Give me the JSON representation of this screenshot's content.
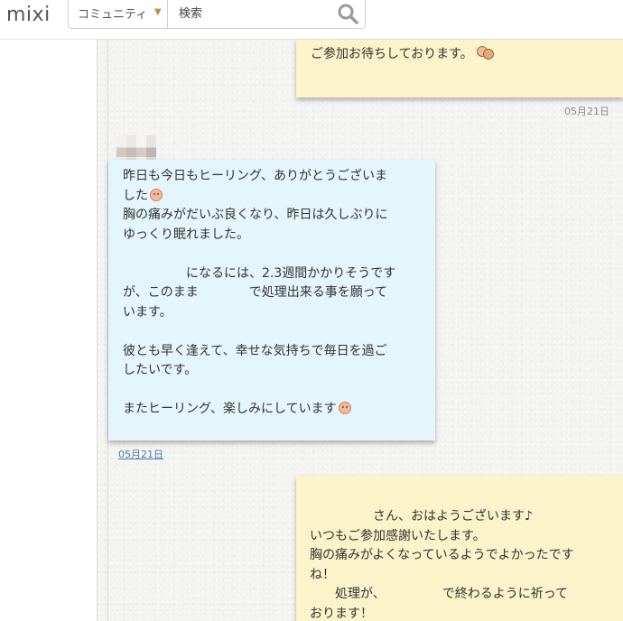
{
  "header": {
    "logo": "mixi",
    "scope_label": "コミュニティ",
    "search_placeholder": "検索"
  },
  "messages": [
    {
      "side": "right",
      "color": "yellow",
      "lines": [
        "ご参加お待ちしております。"
      ],
      "emoji": "faces-emoji",
      "date": "05月21日"
    },
    {
      "side": "left",
      "color": "blue",
      "paragraphs": [
        "昨日も今日もヒーリング、ありがとうございま\nした",
        "胸の痛みがだいぶ良くなり、昨日は久しぶりに\nゆっくり眠れました。",
        "",
        "　　　　　になるには、2.3週間かかりそうです\nが、このまま　　　　で処理出来る事を願って\nいます。",
        "",
        "彼とも早く逢えて、幸せな気持ちで毎日を過ご\nしたいです。",
        "",
        "またヒーリング、楽しみにしています"
      ],
      "date": "05月21日"
    },
    {
      "side": "right",
      "color": "yellow",
      "paragraphs": [
        "　　　　　さん、おはようございます♪",
        "いつもご参加感謝いたします。",
        "胸の痛みがよくなっているようでよかったです\nね！",
        "　　処理が、　　　　　で終わるように祈って\nおります！"
      ]
    }
  ],
  "colors": {
    "yellow_note": "#fbf3c9",
    "blue_note": "#e4f5fb",
    "date_link": "#4a7fa8"
  }
}
